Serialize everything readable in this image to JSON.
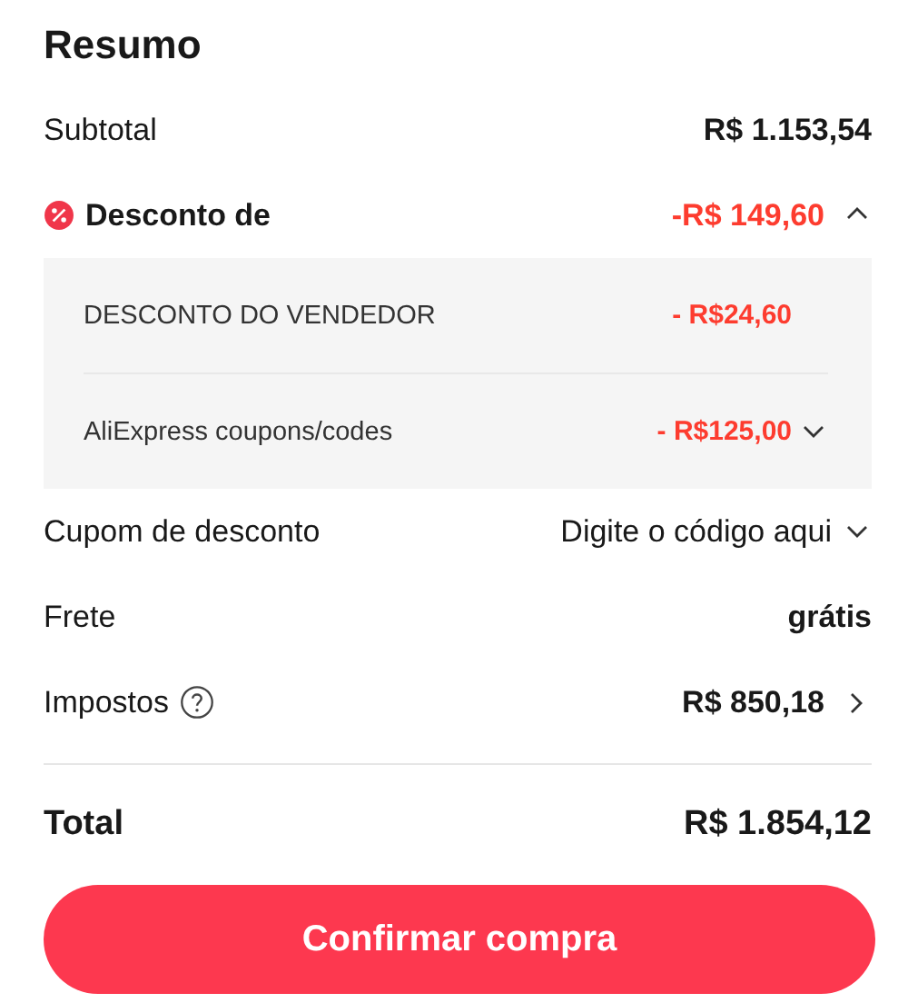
{
  "title": "Resumo",
  "rows": [
    {
      "kind": "plain",
      "label": "Subtotal",
      "value": "R$ 1.153,54"
    },
    {
      "kind": "discount",
      "label": "Desconto de",
      "value": "-R$ 149,60",
      "expanded": true,
      "items": [
        {
          "label": "DESCONTO DO VENDEDOR",
          "value": "- R$24,60"
        },
        {
          "label": "AliExpress coupons/codes",
          "value": "- R$125,00",
          "expanded": false
        }
      ]
    },
    {
      "kind": "coupon",
      "label": "Cupom de desconto",
      "placeholder": "Digite o código aqui"
    },
    {
      "kind": "plain",
      "label": "Frete",
      "value": "grátis"
    },
    {
      "kind": "link",
      "label": "Impostos",
      "value": "R$ 850,18"
    }
  ],
  "total": {
    "label": "Total",
    "value": "R$ 1.854,12"
  },
  "button": "Confirmar compra"
}
